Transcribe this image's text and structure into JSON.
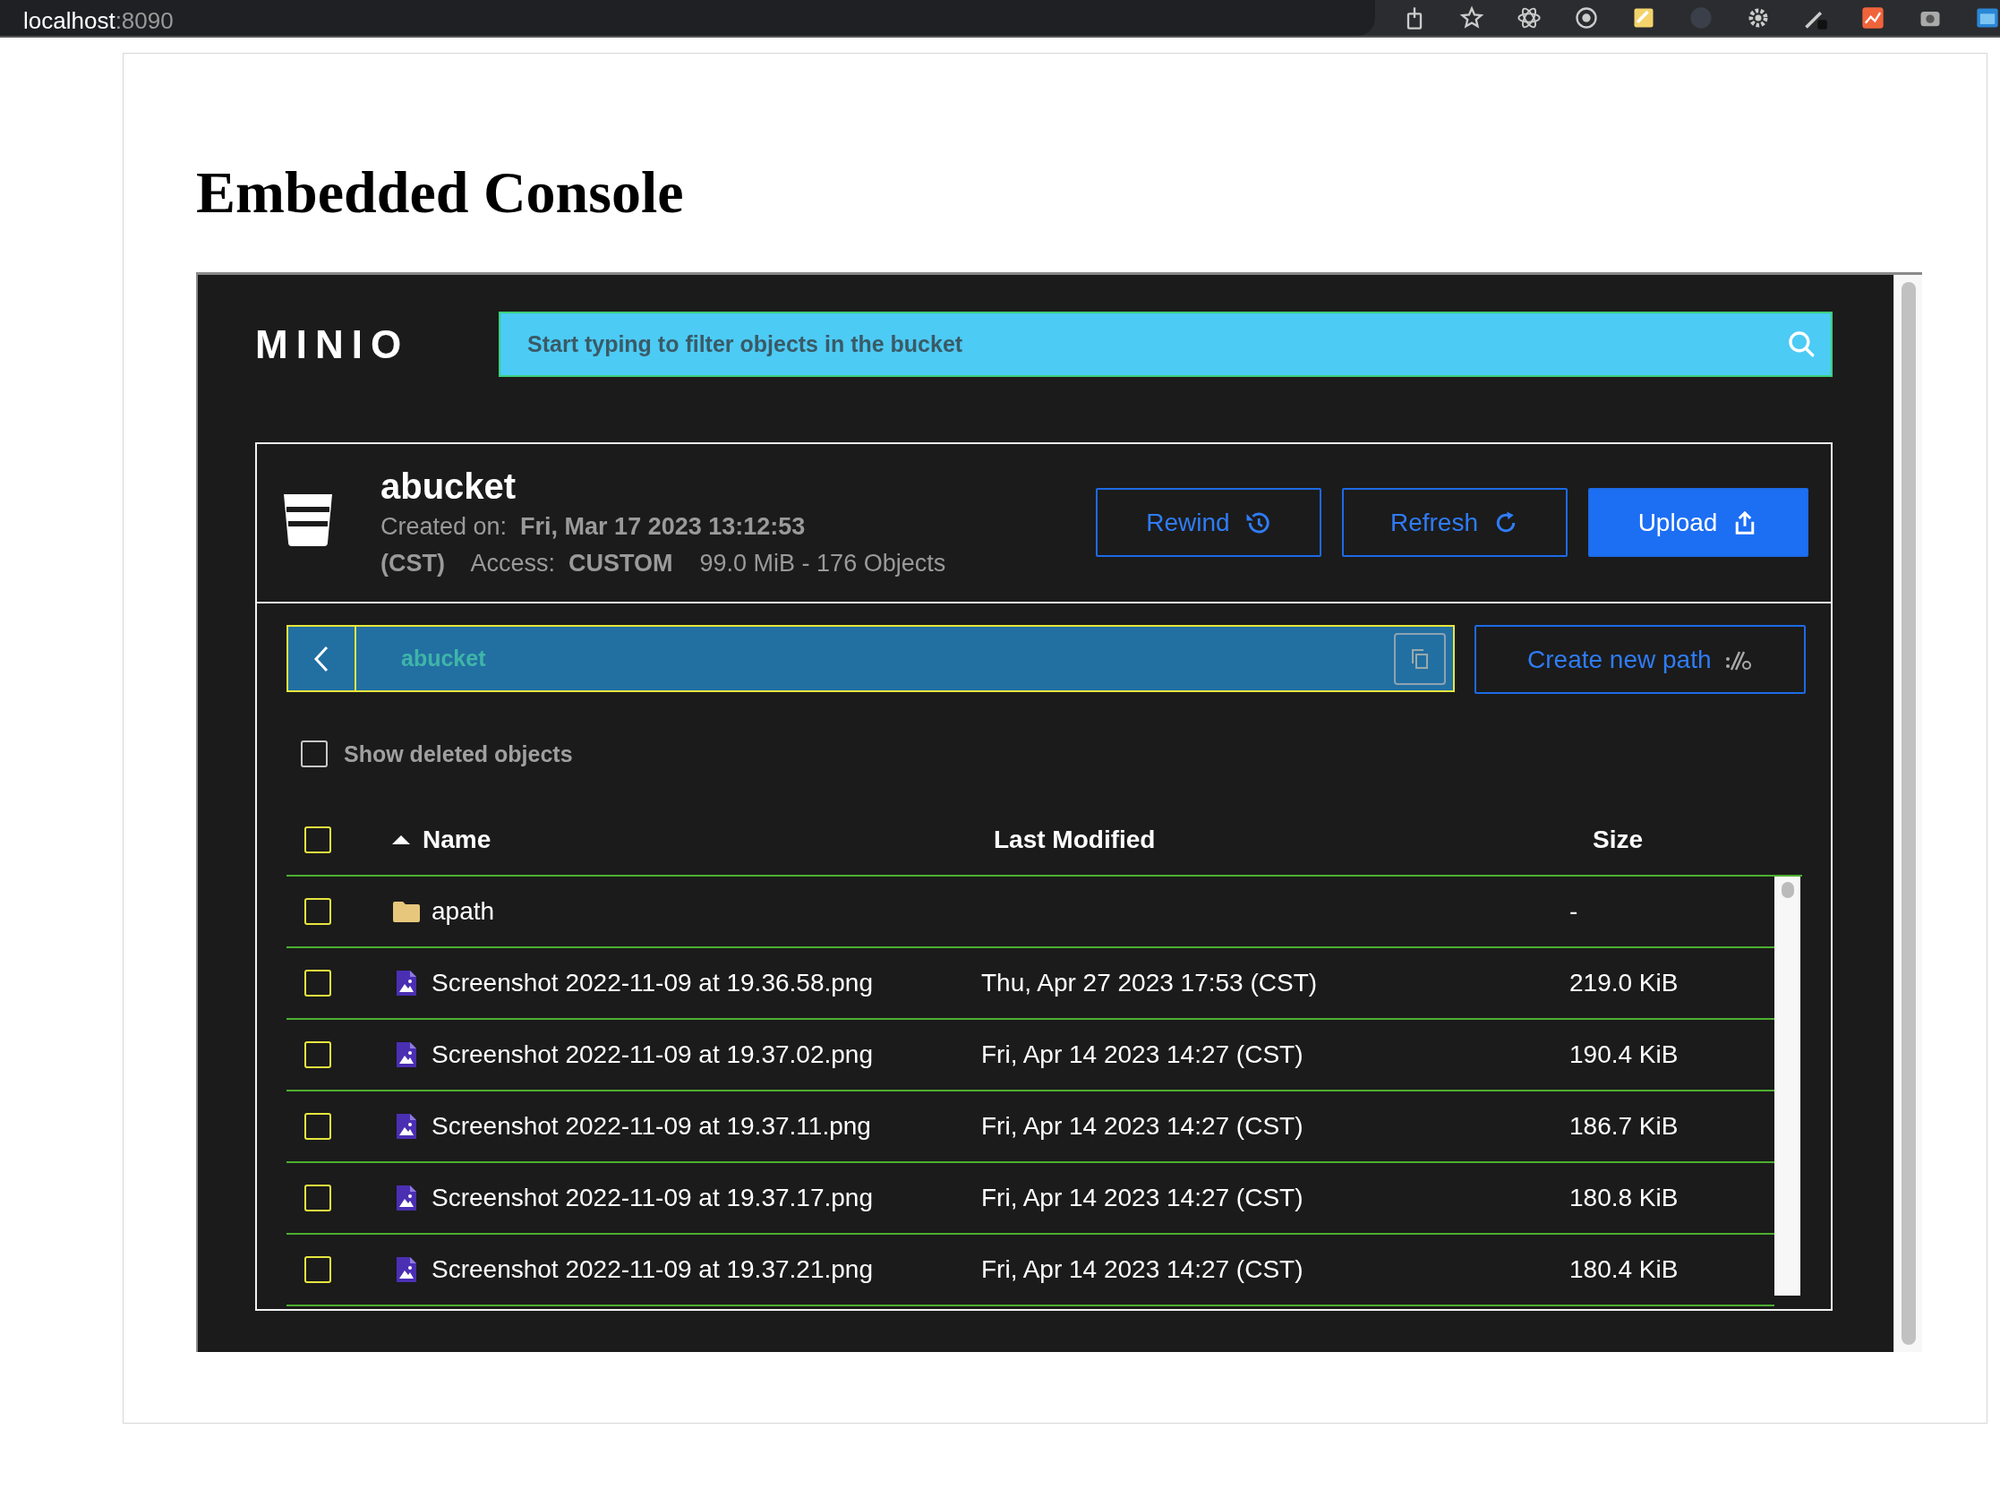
{
  "browser": {
    "host": "localhost",
    "port": ":8090"
  },
  "heading": "Embedded Console",
  "console": {
    "logo": "MINIO",
    "search": {
      "placeholder": "Start typing to filter objects in the bucket"
    },
    "bucket": {
      "name": "abucket",
      "details": "Created on:  **Fri, Mar 17 2023 13:12:53 (CST)**    Access:  **CUSTOM**    99.0 MiB - 176 Objects"
    },
    "actions": [
      {
        "label": "Rewind",
        "kind": "rewind",
        "primary": false
      },
      {
        "label": "Refresh",
        "kind": "refresh",
        "primary": false
      },
      {
        "label": "Upload",
        "kind": "upload",
        "primary": true
      }
    ],
    "path": {
      "crumb": "abucket"
    },
    "create_path": {
      "label": "Create new path"
    },
    "show_deleted": {
      "label": "Show deleted objects",
      "checked": false
    },
    "table": {
      "select_all": {
        "checked": false
      },
      "columns": [
        {
          "label": "Name",
          "sorted": true
        },
        {
          "label": "Last Modified",
          "sorted": false
        },
        {
          "label": "Size",
          "sorted": false
        }
      ],
      "rows": [
        {
          "kind": "folder",
          "name": "apath",
          "modified": "",
          "size": "-",
          "checked": false
        },
        {
          "kind": "file",
          "name": "Screenshot 2022-11-09 at 19.36.58.png",
          "modified": "Thu, Apr 27 2023 17:53 (CST)",
          "size": "219.0 KiB",
          "checked": false
        },
        {
          "kind": "file",
          "name": "Screenshot 2022-11-09 at 19.37.02.png",
          "modified": "Fri, Apr 14 2023 14:27 (CST)",
          "size": "190.4 KiB",
          "checked": false
        },
        {
          "kind": "file",
          "name": "Screenshot 2022-11-09 at 19.37.11.png",
          "modified": "Fri, Apr 14 2023 14:27 (CST)",
          "size": "186.7 KiB",
          "checked": false
        },
        {
          "kind": "file",
          "name": "Screenshot 2022-11-09 at 19.37.17.png",
          "modified": "Fri, Apr 14 2023 14:27 (CST)",
          "size": "180.8 KiB",
          "checked": false
        },
        {
          "kind": "file",
          "name": "Screenshot 2022-11-09 at 19.37.21.png",
          "modified": "Fri, Apr 14 2023 14:27 (CST)",
          "size": "180.4 KiB",
          "checked": false
        }
      ]
    }
  }
}
